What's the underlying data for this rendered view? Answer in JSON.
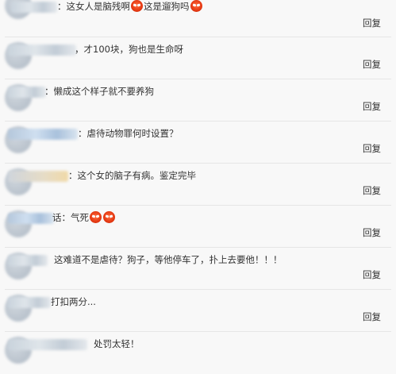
{
  "reply_label": "回复",
  "comments": [
    {
      "text_a": "：这女人是脑残啊",
      "text_b": "这是遛狗吗",
      "emoji_a": "angry-face",
      "emoji_b": "angry-face"
    },
    {
      "text": "，才100块，狗也是生命呀"
    },
    {
      "text": "：懒成这个样子就不要养狗"
    },
    {
      "text": "：虐待动物罪何时设置？"
    },
    {
      "text": "：这个女的脑子有病。鉴定完毕"
    },
    {
      "text": "话：气死",
      "emoji": "angry-face"
    },
    {
      "text": "这难道不是虐待？狗子，等他停车了，扑上去要他！！！"
    },
    {
      "text": "打扣两分..."
    },
    {
      "text": "处罚太轻！"
    }
  ]
}
